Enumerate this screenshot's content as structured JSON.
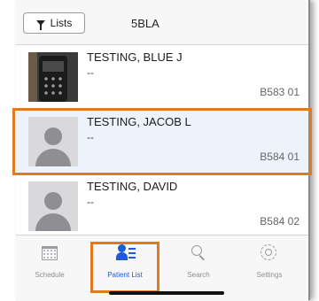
{
  "header": {
    "lists_label": "Lists",
    "unit_title": "5BLA"
  },
  "patients": [
    {
      "name": "TESTING, BLUE J",
      "detail": "--",
      "bed": "B583 01",
      "avatar": "photo"
    },
    {
      "name": "TESTING, JACOB L",
      "detail": "--",
      "bed": "B584 01",
      "avatar": "placeholder"
    },
    {
      "name": "TESTING, DAVID",
      "detail": "--",
      "bed": "B584 02",
      "avatar": "placeholder"
    }
  ],
  "tabs": [
    {
      "label": "Schedule",
      "icon": "calendar-icon"
    },
    {
      "label": "Patient List",
      "icon": "patient-list-icon",
      "active": true
    },
    {
      "label": "Search",
      "icon": "search-icon"
    },
    {
      "label": "Settings",
      "icon": "gear-icon"
    }
  ],
  "colors": {
    "accent": "#1e5bd6",
    "highlight_outline": "#e07a1f"
  }
}
